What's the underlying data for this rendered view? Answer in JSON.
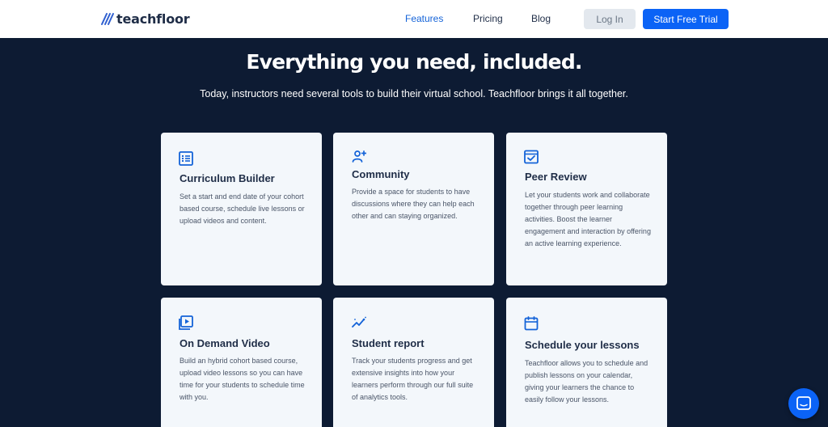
{
  "nav": {
    "brand": "teachfloor",
    "links": [
      "Features",
      "Pricing",
      "Blog"
    ],
    "login": "Log In",
    "cta": "Start Free Trial",
    "active_color": "#1463d8",
    "cta_color": "#0b63f6"
  },
  "hero": {
    "title": "Everything you need, included.",
    "subtitle": "Today, instructors need several tools to build their virtual school. Teachfloor brings it all together."
  },
  "cards": [
    {
      "icon": "list-icon",
      "title": "Curriculum Builder",
      "desc": "Set a start and end date of your cohort based course, schedule live lessons or upload videos and content."
    },
    {
      "icon": "user-plus-icon",
      "title": "Community",
      "desc": "Provide a space for students to have discussions where they can help each other and can staying organized."
    },
    {
      "icon": "check-square-icon",
      "title": "Peer Review",
      "desc": "Let your students work and collaborate together through peer learning activities. Boost the learner engagement and interaction by offering an active learning experience."
    },
    {
      "icon": "video-play-icon",
      "title": "On Demand Video",
      "desc": "Build an hybrid cohort based course, upload video lessons so you can have time for your students to schedule time with you."
    },
    {
      "icon": "analytics-icon",
      "title": "Student report",
      "desc": "Track your students progress and get extensive insights into how your learners perform through our full suite of analytics tools."
    },
    {
      "icon": "calendar-icon",
      "title": "Schedule your lessons",
      "desc": "Teachfloor allows you to schedule and publish lessons on your calendar, giving your learners the chance to easily follow your lessons."
    }
  ],
  "colors": {
    "background": "#0d1b33",
    "card": "#f3f7fb",
    "icon": "#1463d8"
  },
  "chat": {
    "icon": "chat-icon"
  }
}
